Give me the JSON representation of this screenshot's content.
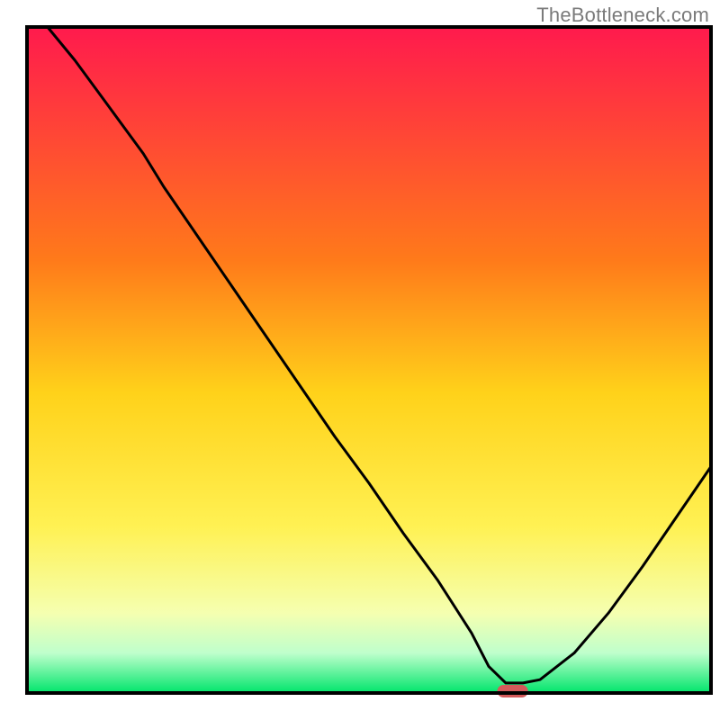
{
  "watermark": "TheBottleneck.com",
  "chart_data": {
    "type": "line",
    "title": "",
    "xlabel": "",
    "ylabel": "",
    "xlim": [
      0,
      100
    ],
    "ylim": [
      0,
      100
    ],
    "x": [
      3,
      7,
      12,
      17,
      20,
      25,
      30,
      35,
      40,
      45,
      50,
      55,
      60,
      65,
      67.5,
      70,
      72.5,
      75,
      80,
      85,
      90,
      95,
      100
    ],
    "values": [
      100,
      95,
      88,
      81,
      76,
      68.5,
      61,
      53.5,
      46,
      38.5,
      31.5,
      24,
      17,
      9,
      4,
      1.5,
      1.5,
      2,
      6,
      12,
      19,
      26.5,
      34
    ],
    "marker": {
      "x_center": 71,
      "width": 4.5,
      "label": "optimal-point"
    },
    "gradient_stops": [
      {
        "pct": 0,
        "color": "#ff1a4d"
      },
      {
        "pct": 35,
        "color": "#ff7a1a"
      },
      {
        "pct": 55,
        "color": "#ffd21a"
      },
      {
        "pct": 75,
        "color": "#fff153"
      },
      {
        "pct": 88,
        "color": "#f5ffb0"
      },
      {
        "pct": 94,
        "color": "#bfffcc"
      },
      {
        "pct": 100,
        "color": "#00e56b"
      }
    ],
    "border": true,
    "line_color": "#000000",
    "line_width": 3,
    "marker_color": "#d45a5a"
  }
}
